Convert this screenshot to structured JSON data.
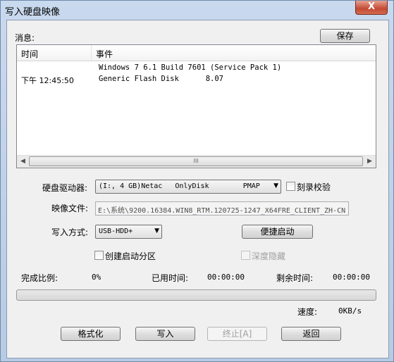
{
  "window": {
    "title": "写入硬盘映像",
    "close_glyph": "X"
  },
  "messages": {
    "label": "消息:",
    "save_button": "保存",
    "columns": [
      "时间",
      "事件"
    ],
    "rows": [
      {
        "time": "",
        "event": "Windows 7 6.1 Build 7601 (Service Pack 1)"
      },
      {
        "time": "下午 12:45:50",
        "event": "Generic Flash Disk      8.07"
      }
    ],
    "scroll_grip": "III"
  },
  "drive": {
    "label": "硬盘驱动器:",
    "selected": "(I:, 4 GB)Netac   OnlyDisk        PMAP",
    "verify_label": "刻录校验"
  },
  "image_file": {
    "label": "映像文件:",
    "value": "E:\\系统\\9200.16384.WIN8_RTM.120725-1247_X64FRE_CLIENT_ZH-CN"
  },
  "write_mode": {
    "label": "写入方式:",
    "selected": "USB-HDD+",
    "quick_boot_button": "便捷启动"
  },
  "options": {
    "create_boot_partition": "创建启动分区",
    "deep_hide": "深度隐藏"
  },
  "status": {
    "percent_label": "完成比例:",
    "percent_value": "0%",
    "elapsed_label": "已用时间:",
    "elapsed_value": "00:00:00",
    "remaining_label": "剩余时间:",
    "remaining_value": "00:00:00",
    "progress_fraction": 0,
    "speed_label": "速度:",
    "speed_value": "0KB/s"
  },
  "buttons": {
    "format": "格式化",
    "write": "写入",
    "abort": "终止[A]",
    "back": "返回"
  },
  "colors": {
    "progress_fill": "#37b24d",
    "close_red": "#c44a32"
  }
}
